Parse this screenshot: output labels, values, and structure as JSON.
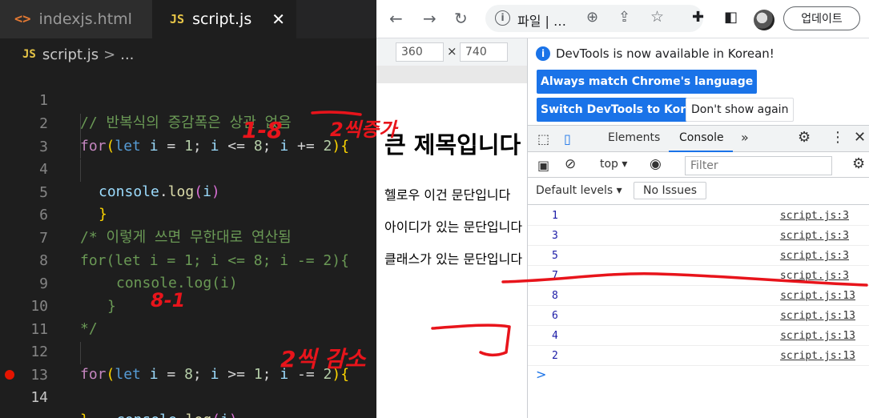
{
  "editor": {
    "tabs": [
      {
        "icon": "<>",
        "label": "indexjs.html"
      },
      {
        "icon": "JS",
        "label": "script.js"
      }
    ],
    "close_glyph": "✕",
    "breadcrumb": {
      "icon": "JS",
      "file": "script.js",
      "sep": ">",
      "rest": "..."
    },
    "lines": [
      {
        "n": "1",
        "comment": "// 반복식의 증감폭은 상관 없음"
      },
      {
        "n": "2",
        "for": "for",
        "lp": "(",
        "let": "let",
        "var1": "i",
        "eq": " = ",
        "start": "1",
        "semi1": "; ",
        "var2": "i",
        "cmp": " <= ",
        "end": "8",
        "semi2": "; ",
        "var3": "i",
        "step_op": " += ",
        "step": "2",
        "rp": ")",
        "brace": "{"
      },
      {
        "n": "3",
        "obj": "console",
        "dot": ".",
        "fn": "log",
        "lp": "(",
        "arg": "i",
        "rp": ")"
      },
      {
        "n": "4",
        "brace": "}"
      },
      {
        "n": "5"
      },
      {
        "n": "6",
        "comment": "/* 이렇게 쓰면 무한대로 연산됨"
      },
      {
        "n": "7",
        "comment": "for(let i = 1; i <= 8; i -= 2){"
      },
      {
        "n": "8",
        "comment": "console.log(i)"
      },
      {
        "n": "9",
        "comment": "}"
      },
      {
        "n": "10",
        "comment": "*/"
      },
      {
        "n": "11"
      },
      {
        "n": "12",
        "for": "for",
        "lp": "(",
        "let": "let",
        "var1": "i",
        "eq": " = ",
        "start": "8",
        "semi1": "; ",
        "var2": "i",
        "cmp": " >= ",
        "end": "1",
        "semi2": "; ",
        "var3": "i",
        "step_op": " -= ",
        "step": "2",
        "rp": ")",
        "brace": "{"
      },
      {
        "n": "13",
        "obj": "console",
        "dot": ".",
        "fn": "log",
        "lp": "(",
        "arg": "i",
        "rp": ")"
      },
      {
        "n": "14",
        "brace": "}"
      }
    ]
  },
  "annotations": {
    "a1": "1-8",
    "a2": "2씩증가",
    "a3": "8-1",
    "a4": "2씩 감소"
  },
  "browser": {
    "omnibox_text": "파일 |  …",
    "update_button": "업데이트",
    "device": {
      "width": "360",
      "height": "740",
      "x": "×"
    },
    "page": {
      "heading": "큰 제목입니다",
      "p1": "헬로우 이건 문단입니다",
      "p2": "아이디가 있는 문단입니다",
      "p3": "클래스가 있는 문단입니다"
    },
    "devtools": {
      "info": "DevTools is now available in Korean!",
      "btn_match": "Always match Chrome's language",
      "btn_switch": "Switch DevTools to Korean",
      "btn_dont": "Don't show again",
      "tabs": {
        "elements": "Elements",
        "console": "Console",
        "more": "»"
      },
      "context": "top",
      "filter_placeholder": "Filter",
      "levels": "Default levels",
      "issues": "No Issues",
      "rows": [
        {
          "value": "1",
          "src": "script.js:3"
        },
        {
          "value": "3",
          "src": "script.js:3"
        },
        {
          "value": "5",
          "src": "script.js:3"
        },
        {
          "value": "7",
          "src": "script.js:3"
        },
        {
          "value": "8",
          "src": "script.js:13"
        },
        {
          "value": "6",
          "src": "script.js:13"
        },
        {
          "value": "4",
          "src": "script.js:13"
        },
        {
          "value": "2",
          "src": "script.js:13"
        }
      ],
      "prompt": ">"
    }
  }
}
